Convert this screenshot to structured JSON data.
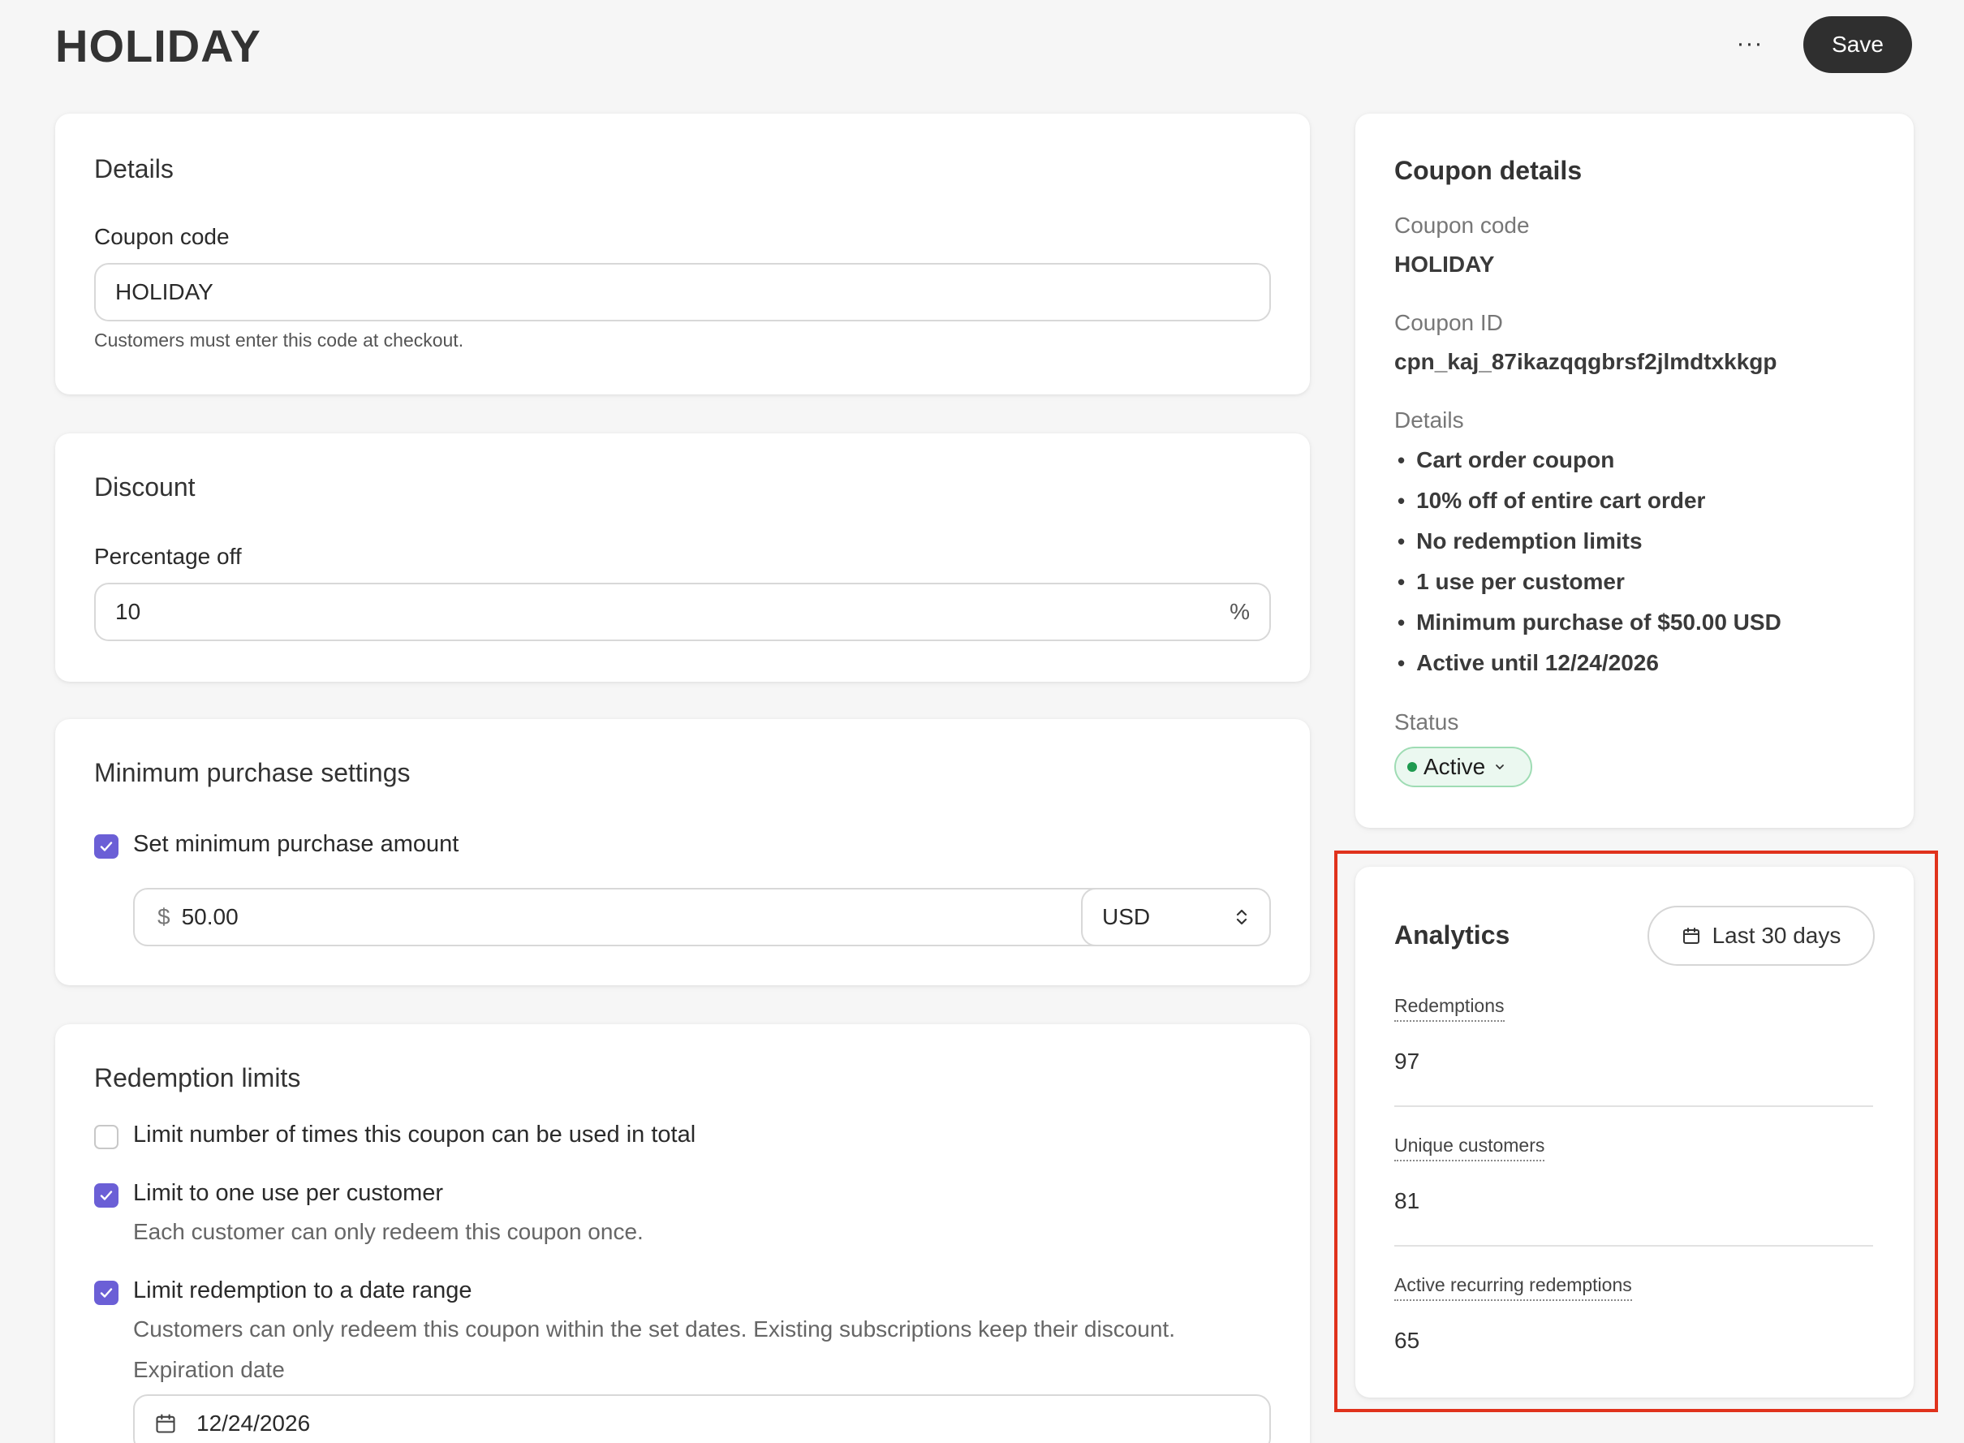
{
  "header": {
    "title": "HOLIDAY",
    "more_label": "···",
    "save_label": "Save"
  },
  "details_card": {
    "title": "Details",
    "coupon_code_label": "Coupon code",
    "coupon_code_value": "HOLIDAY",
    "coupon_code_help": "Customers must enter this code at checkout."
  },
  "discount_card": {
    "title": "Discount",
    "percentage_label": "Percentage off",
    "percentage_value": "10",
    "percentage_suffix": "%"
  },
  "minimum_card": {
    "title": "Minimum purchase settings",
    "set_minimum_label": "Set minimum purchase amount",
    "set_minimum_checked": true,
    "currency_symbol": "$",
    "amount_value": "50.00",
    "currency_value": "USD"
  },
  "redemption_card": {
    "title": "Redemption limits",
    "limit_total_label": "Limit number of times this coupon can be used in total",
    "limit_total_checked": false,
    "limit_one_label": "Limit to one use per customer",
    "limit_one_checked": true,
    "limit_one_desc": "Each customer can only redeem this coupon once.",
    "limit_date_label": "Limit redemption to a date range",
    "limit_date_checked": true,
    "limit_date_desc": "Customers can only redeem this coupon within the set dates. Existing subscriptions keep their discount.",
    "expiration_label": "Expiration date",
    "expiration_value": "12/24/2026"
  },
  "coupon_details": {
    "title": "Coupon details",
    "code_label": "Coupon code",
    "code_value": "HOLIDAY",
    "id_label": "Coupon ID",
    "id_value": "cpn_kaj_87ikazqqgbrsf2jlmdtxkkgp",
    "details_label": "Details",
    "details_items": [
      "Cart order coupon",
      "10% off of entire cart order",
      "No redemption limits",
      "1 use per customer",
      "Minimum purchase of $50.00 USD",
      "Active until 12/24/2026"
    ],
    "status_label": "Status",
    "status_value": "Active",
    "status_color": "#1e9a4f"
  },
  "analytics": {
    "title": "Analytics",
    "range_label": "Last 30 days",
    "metrics": [
      {
        "label": "Redemptions",
        "value": "97"
      },
      {
        "label": "Unique customers",
        "value": "81"
      },
      {
        "label": "Active recurring redemptions",
        "value": "65"
      }
    ]
  },
  "colors": {
    "accent": "#6b5fd6",
    "highlight": "#e0321c",
    "save_bg": "#2f2f2f"
  }
}
